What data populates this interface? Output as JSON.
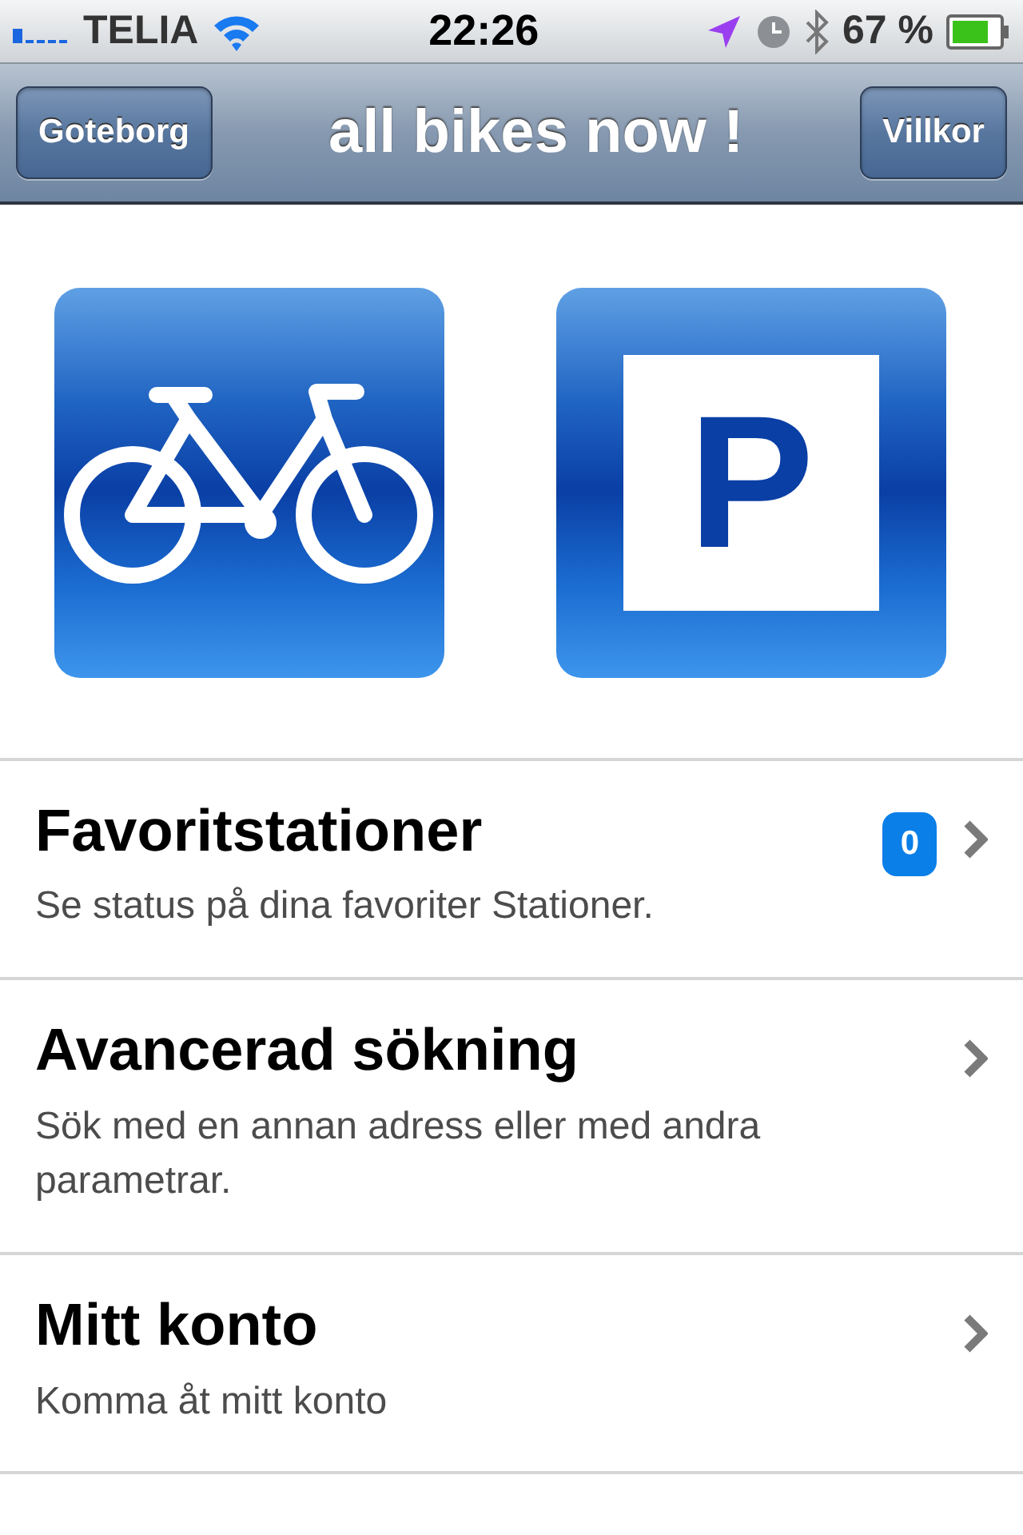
{
  "status_bar": {
    "carrier": "TELIA",
    "time": "22:26",
    "battery": "67 %"
  },
  "nav_bar": {
    "left_button": "Goteborg",
    "title": "all bikes now !",
    "right_button": "Villkor"
  },
  "tiles": [
    {
      "kind": "bike"
    },
    {
      "kind": "parking",
      "label": "P"
    }
  ],
  "menu": [
    {
      "title": "Favoritstationer",
      "subtitle": "Se status på dina favoriter Stationer.",
      "badge": "0"
    },
    {
      "title": "Avancerad sökning",
      "subtitle": "Sök med en annan adress eller med andra parametrar."
    },
    {
      "title": "Mitt konto",
      "subtitle": "Komma åt mitt konto"
    }
  ]
}
